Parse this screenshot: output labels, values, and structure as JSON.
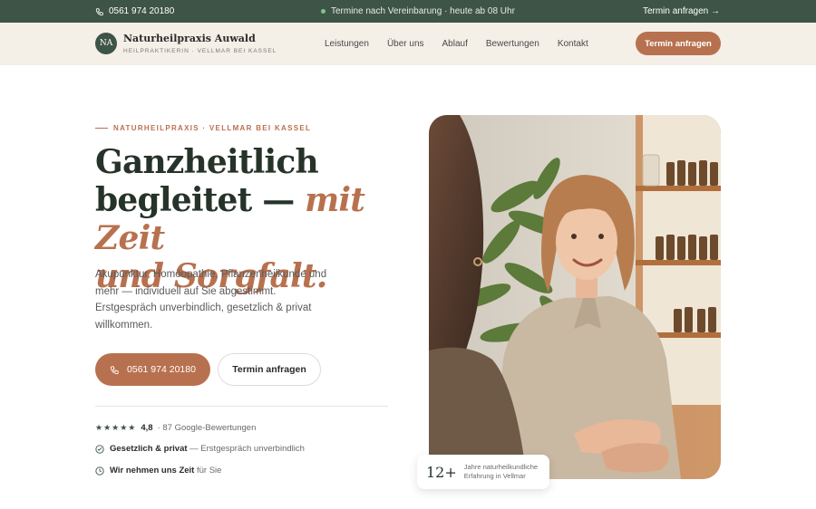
{
  "topbar": {
    "phone": "0561 974 20180",
    "notice": "Termine nach Vereinbarung · heute ab 08 Uhr",
    "cta": "Termin anfragen →"
  },
  "header": {
    "logo_initials": "NA",
    "brand_name": "Naturheilpraxis Auwald",
    "brand_sub": "HEILPRAKTIKERIN · VELLMAR BEI KASSEL",
    "nav": [
      "Leistungen",
      "Über uns",
      "Ablauf",
      "Bewertungen",
      "Kontakt"
    ],
    "cta": "Termin anfragen"
  },
  "hero": {
    "eyebrow": "NATURHEILPRAXIS · VELLMAR BEI KASSEL",
    "headline_line1": "Ganzheitlich",
    "headline_line2a": "begleitet — ",
    "headline_line2b": "mit Zeit",
    "headline_line3": "und Sorgfalt.",
    "lead": "Akupunktur, Homöopathie, Pflanzenheilkunde und mehr — individuell auf Sie abgestimmt. Erstgespräch unverbindlich, gesetzlich & privat willkommen.",
    "primary_button": "0561 974 20180",
    "secondary_button": "Termin anfragen",
    "rating_stars": "★★★★★",
    "rating_score": "4,8",
    "rating_text": "· 87 Google-Bewertungen",
    "feature1_bold": "Gesetzlich & privat",
    "feature1_text": "— Erstgespräch unverbindlich",
    "feature2_bold": "Wir nehmen uns Zeit",
    "feature2_text": "für Sie"
  },
  "stat": {
    "number": "12+",
    "text": "Jahre naturheilkundliche Erfahrung in Vellmar"
  },
  "colors": {
    "green": "#3e5446",
    "accent": "#b8714f",
    "cream": "#f4efe7"
  }
}
